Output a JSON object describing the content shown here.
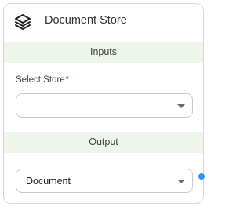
{
  "node": {
    "title": "Document Store",
    "icon": "layers-icon",
    "inputs_label": "Inputs",
    "store_label": "Select Store",
    "required_mark": "*",
    "store_value": "",
    "output_label": "Output",
    "output_value": "Document"
  },
  "colors": {
    "section_bg": "#eef5ea",
    "required": "#e53935",
    "handle": "#3b8ff0"
  }
}
